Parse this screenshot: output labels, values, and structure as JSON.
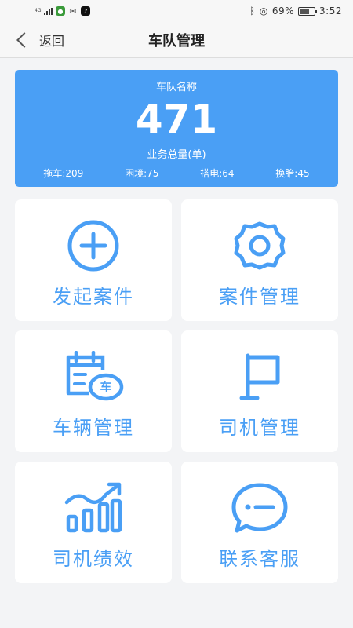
{
  "status_bar": {
    "network": "4G",
    "battery": "69%",
    "battery_level": 0.69,
    "time": "3:52",
    "icons": [
      "signal-icon",
      "battery-saver-app-icon",
      "wechat-icon",
      "tiktok-icon",
      "bluetooth-icon",
      "location-icon",
      "battery-icon"
    ]
  },
  "header": {
    "back_label": "返回",
    "title": "车队管理"
  },
  "summary": {
    "team_name": "车队名称",
    "total": "471",
    "total_label": "业务总量(单)",
    "stats": [
      {
        "label": "拖车:209"
      },
      {
        "label": "困境:75"
      },
      {
        "label": "搭电:64"
      },
      {
        "label": "换胎:45"
      }
    ],
    "bg_color": "#4a9ff5"
  },
  "tiles": [
    {
      "label": "发起案件",
      "icon": "plus-circle-icon"
    },
    {
      "label": "案件管理",
      "icon": "gear-icon"
    },
    {
      "label": "车辆管理",
      "icon": "vehicle-calendar-icon",
      "icon_text": "车"
    },
    {
      "label": "司机管理",
      "icon": "flag-icon"
    },
    {
      "label": "司机绩效",
      "icon": "performance-chart-icon"
    },
    {
      "label": "联系客服",
      "icon": "chat-bubble-icon"
    }
  ],
  "accent_color": "#4a9ff5"
}
